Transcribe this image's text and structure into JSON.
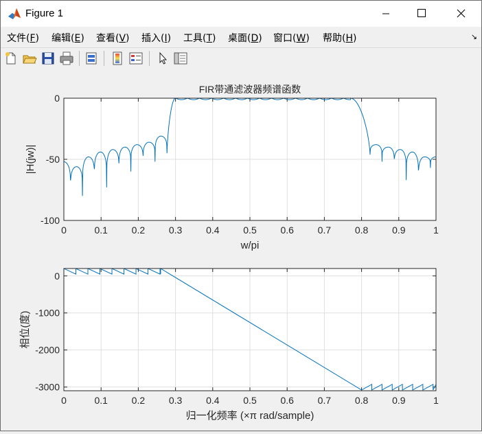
{
  "window": {
    "title": "Figure 1"
  },
  "menu": {
    "items": [
      "文件(F)",
      "编辑(E)",
      "查看(V)",
      "插入(I)",
      "工具(T)",
      "桌面(D)",
      "窗口(W)",
      "帮助(H)"
    ],
    "underline_keys": [
      "F",
      "E",
      "V",
      "I",
      "T",
      "D",
      "W",
      "H"
    ]
  },
  "toolbar": {
    "icons": [
      "new-figure-icon",
      "open-file-icon",
      "save-icon",
      "print-icon",
      "link-icon",
      "colorbar-icon",
      "legend-icon",
      "pointer-icon",
      "property-inspector-icon"
    ]
  },
  "colors": {
    "line": "#0072bd",
    "grid": "#dfdfdf",
    "axes_bg": "#ffffff",
    "figure_bg": "#f0f0f0"
  },
  "chart_data": [
    {
      "type": "line",
      "title": "FIR带通滤波器频谱函数",
      "xlabel": "w/pi",
      "ylabel": "|H(jw)|",
      "xlim": [
        0,
        1
      ],
      "ylim": [
        -100,
        0
      ],
      "xticks": [
        "0",
        "0.1",
        "0.2",
        "0.3",
        "0.4",
        "0.5",
        "0.6",
        "0.7",
        "0.8",
        "0.9",
        "1"
      ],
      "yticks": [
        "0",
        "-50",
        "-100"
      ],
      "grid": true,
      "series": [
        {
          "passband": [
            0.3,
            0.77
          ],
          "passband_level": 0,
          "stopband_nulls": [
            0.018,
            0.05,
            0.082,
            0.115,
            0.148,
            0.18,
            0.213,
            0.245,
            0.277,
            0.823,
            0.855,
            0.888,
            0.92,
            0.953,
            0.985
          ],
          "stopband_peaks": [
            -52,
            -56,
            -48,
            -44,
            -42,
            -40,
            -38,
            -36,
            -31,
            -36,
            -38,
            -40,
            -42,
            -44,
            -48
          ],
          "null_depths": [
            -80,
            -80,
            -70,
            -73,
            -63,
            -60,
            -55,
            -52,
            -48,
            -48,
            -52,
            -58,
            -67,
            -72,
            -57
          ]
        }
      ]
    },
    {
      "type": "line",
      "title": "",
      "xlabel": "归一化频率  (×π rad/sample)",
      "ylabel": "相位(度)",
      "xlim": [
        0,
        1
      ],
      "ylim": [
        -3100,
        200
      ],
      "xticks": [
        "0",
        "0.1",
        "0.2",
        "0.3",
        "0.4",
        "0.5",
        "0.6",
        "0.7",
        "0.8",
        "0.9",
        "1"
      ],
      "yticks": [
        "0",
        "-1000",
        "-2000",
        "-3000"
      ],
      "grid": true,
      "series": [
        {
          "x": [
            0,
            0.26,
            0.26,
            0.8,
            1
          ],
          "y": [
            200,
            200,
            190,
            -3080,
            -3080
          ],
          "sawtooth_period": 0.0323,
          "sawtooth_amplitude": 180
        }
      ]
    }
  ]
}
